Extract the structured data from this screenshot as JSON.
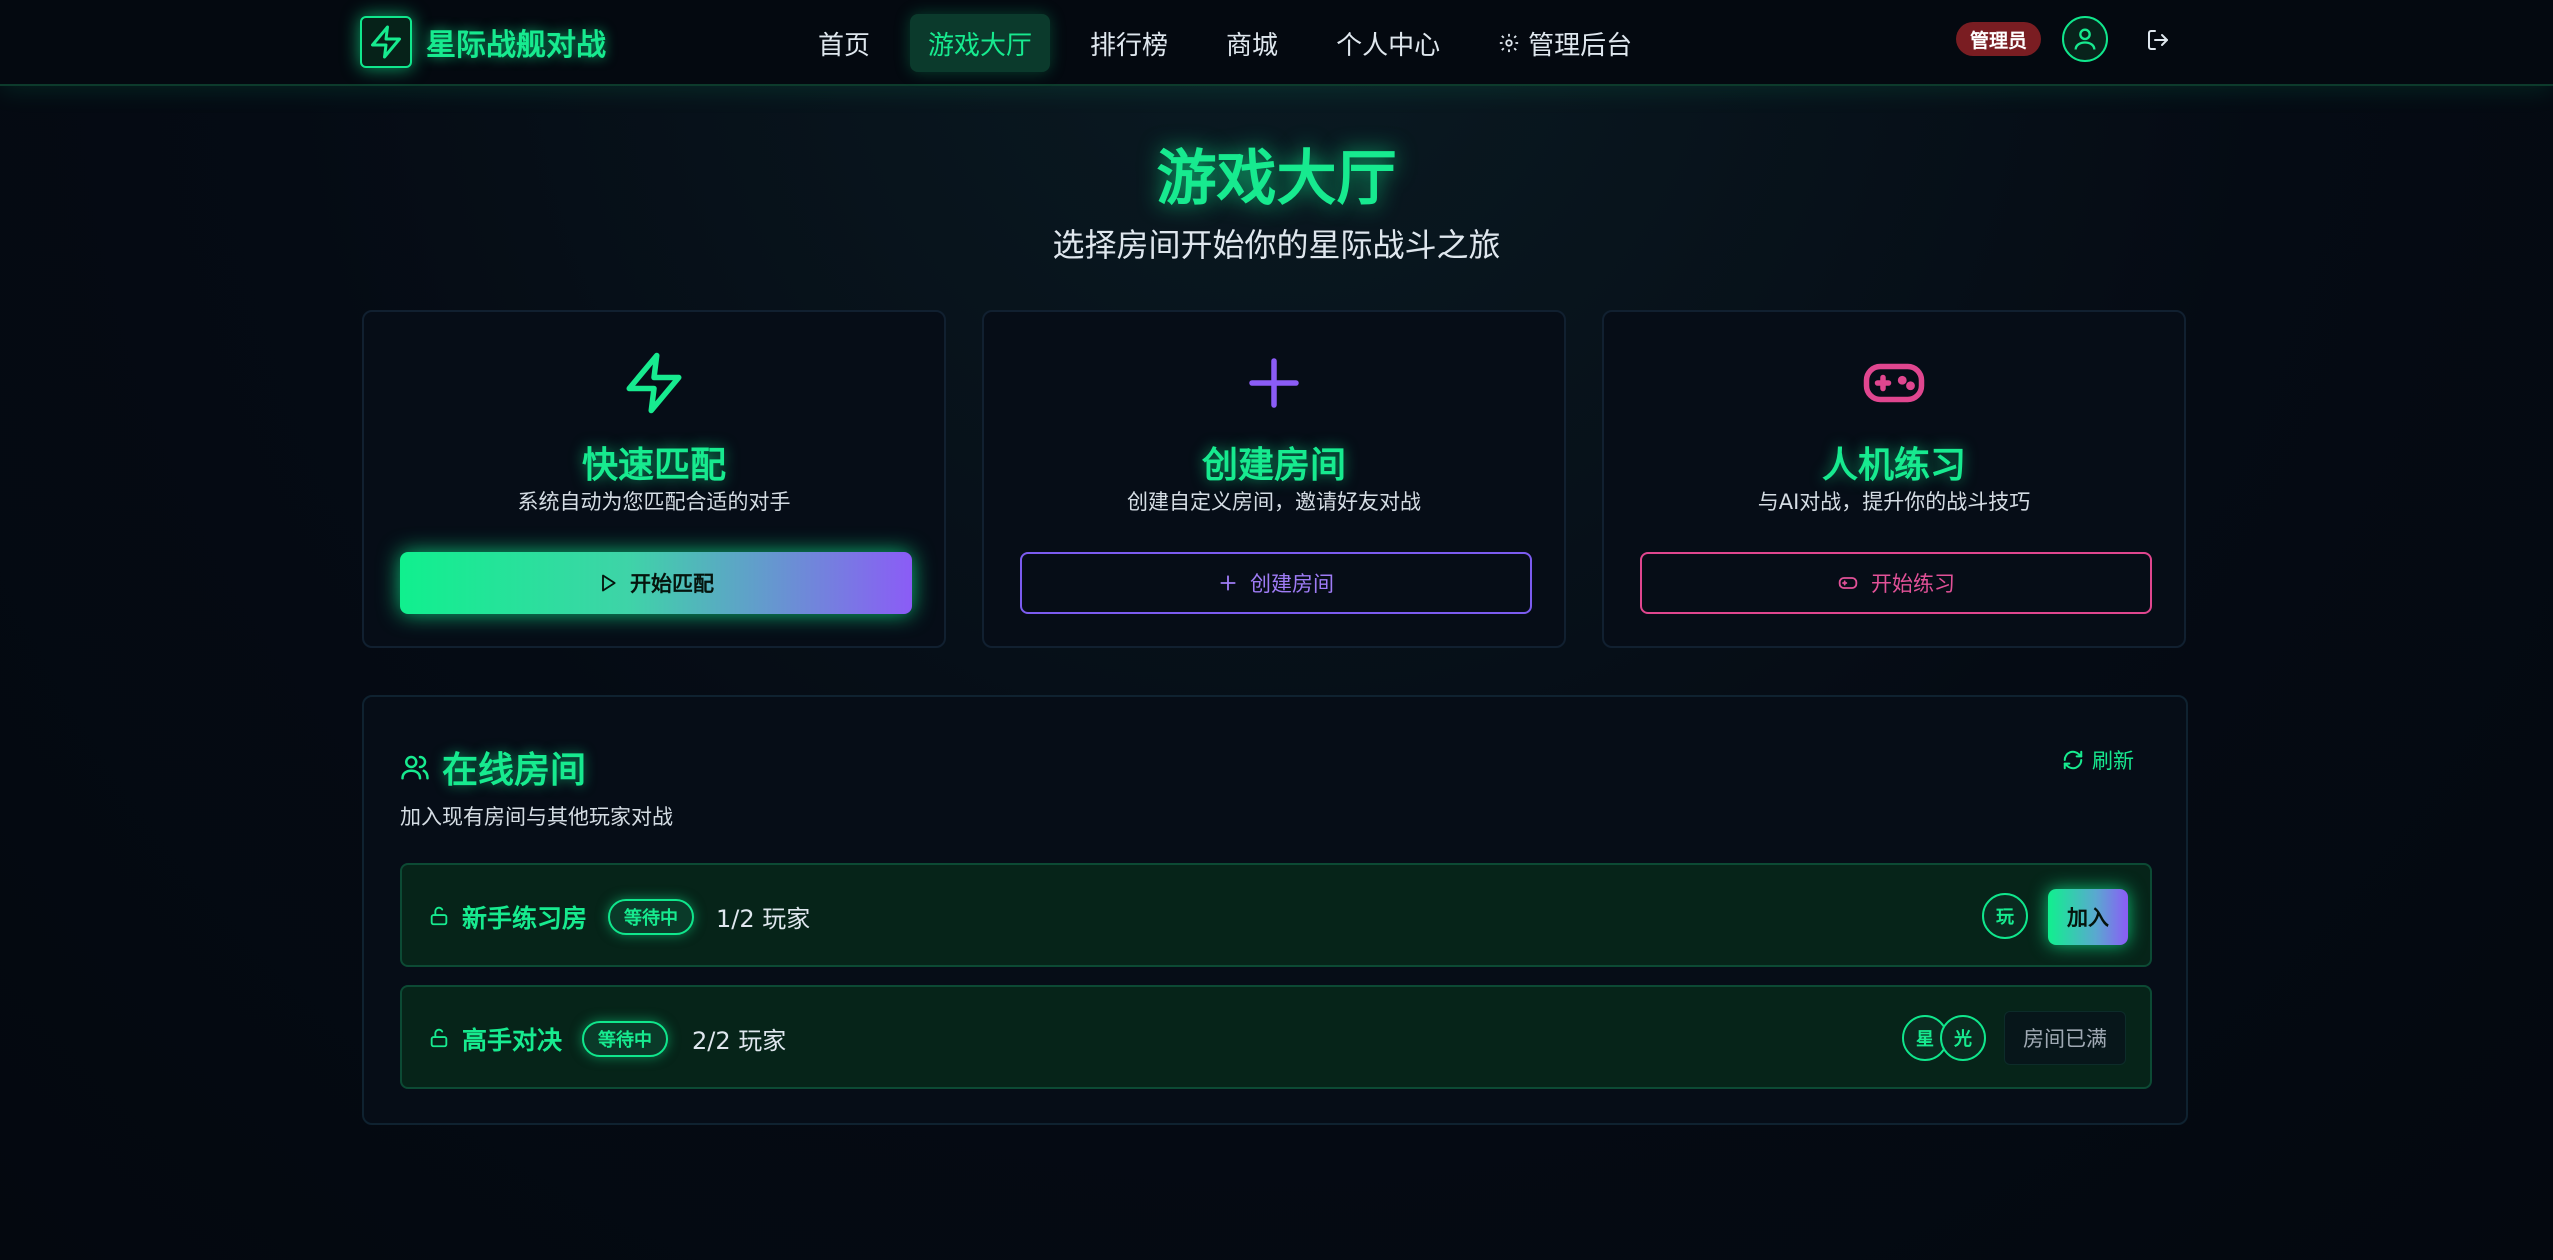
{
  "nav": {
    "brand": "星际战舰对战",
    "links": [
      "首页",
      "游戏大厅",
      "排行榜",
      "商城",
      "个人中心",
      "管理后台"
    ],
    "active_index": 1,
    "admin_badge": "管理员",
    "icons": {
      "brand": "lightning-icon",
      "admin": "gear-icon",
      "avatar": "user-avatar-icon",
      "logout": "logout-icon"
    }
  },
  "hero": {
    "title": "游戏大厅",
    "subtitle": "选择房间开始你的星际战斗之旅"
  },
  "cards": [
    {
      "title": "快速匹配",
      "desc": "系统自动为您匹配合适的对手",
      "button": "开始匹配",
      "icon": "lightning-icon",
      "accent": "#17ea8f"
    },
    {
      "title": "创建房间",
      "desc": "创建自定义房间，邀请好友对战",
      "button": "创建房间",
      "icon": "plus-icon",
      "accent": "#8b5cf6"
    },
    {
      "title": "人机练习",
      "desc": "与AI对战，提升你的战斗技巧",
      "button": "开始练习",
      "icon": "gamepad-icon",
      "accent": "#e0468f"
    }
  ],
  "rooms": {
    "title": "在线房间",
    "subtitle": "加入现有房间与其他玩家对战",
    "refresh": "刷新",
    "list": [
      {
        "name": "新手练习房",
        "status": "等待中",
        "players": "1/2 玩家",
        "avatars": [
          "玩"
        ],
        "action": "加入"
      },
      {
        "name": "高手对决",
        "status": "等待中",
        "players": "2/2 玩家",
        "avatars": [
          "星",
          "光"
        ],
        "action": "房间已满"
      }
    ]
  },
  "colors": {
    "accent": "#17ea8f",
    "purple": "#8b5cf6",
    "pink": "#e0468f",
    "background": "#050b14",
    "admin_badge": "#7a1d22"
  }
}
